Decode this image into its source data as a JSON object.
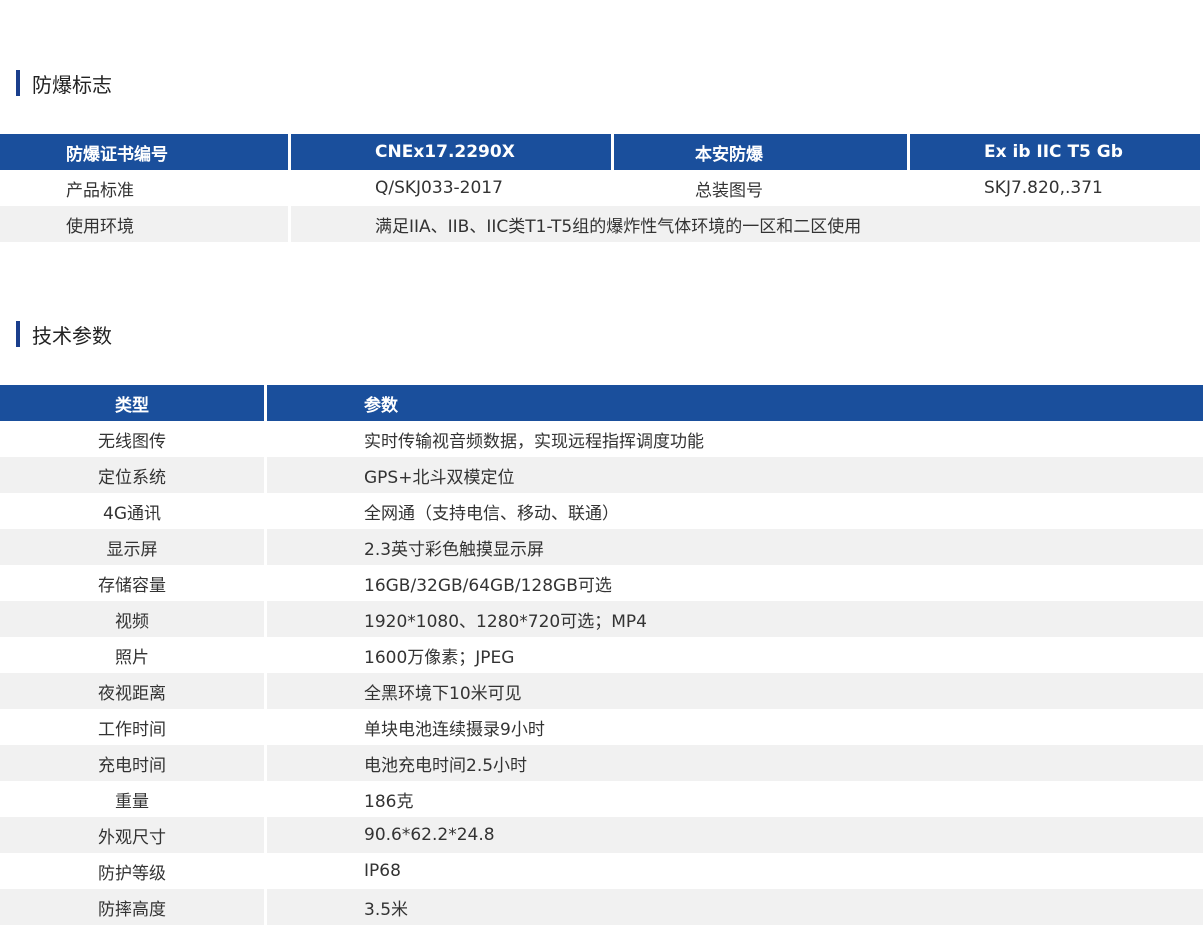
{
  "sections": {
    "explosion_title": "防爆标志",
    "spec_title": "技术参数"
  },
  "explosion_table": {
    "header": [
      "防爆证书编号",
      "CNEx17.2290X",
      "本安防爆",
      "Ex ib IIC T5 Gb"
    ],
    "row1": [
      "产品标准",
      "Q/SKJ033-2017",
      "总装图号",
      "SKJ7.820,.371"
    ],
    "row2": [
      "使用环境",
      "满足IIA、IIB、IIC类T1-T5组的爆炸性气体环境的一区和二区使用"
    ]
  },
  "spec_table": {
    "header": [
      "类型",
      "参数"
    ],
    "rows": [
      [
        "无线图传",
        "实时传输视音频数据，实现远程指挥调度功能"
      ],
      [
        "定位系统",
        "GPS+北斗双模定位"
      ],
      [
        "4G通讯",
        "全网通（支持电信、移动、联通）"
      ],
      [
        "显示屏",
        "2.3英寸彩色触摸显示屏"
      ],
      [
        "存储容量",
        "16GB/32GB/64GB/128GB可选"
      ],
      [
        "视频",
        "1920*1080、1280*720可选；MP4"
      ],
      [
        "照片",
        "1600万像素；JPEG"
      ],
      [
        "夜视距离",
        "全黑环境下10米可见"
      ],
      [
        "工作时间",
        "单块电池连续摄录9小时"
      ],
      [
        "充电时间",
        "电池充电时间2.5小时"
      ],
      [
        "重量",
        "186克"
      ],
      [
        "外观尺寸",
        "90.6*62.2*24.8"
      ],
      [
        "防护等级",
        "IP68"
      ],
      [
        "防摔高度",
        "3.5米"
      ]
    ]
  },
  "colors": {
    "header_bg": "#1a4f9c",
    "accent_bar": "#1a3e8c",
    "alt_row": "#f1f1f1"
  }
}
